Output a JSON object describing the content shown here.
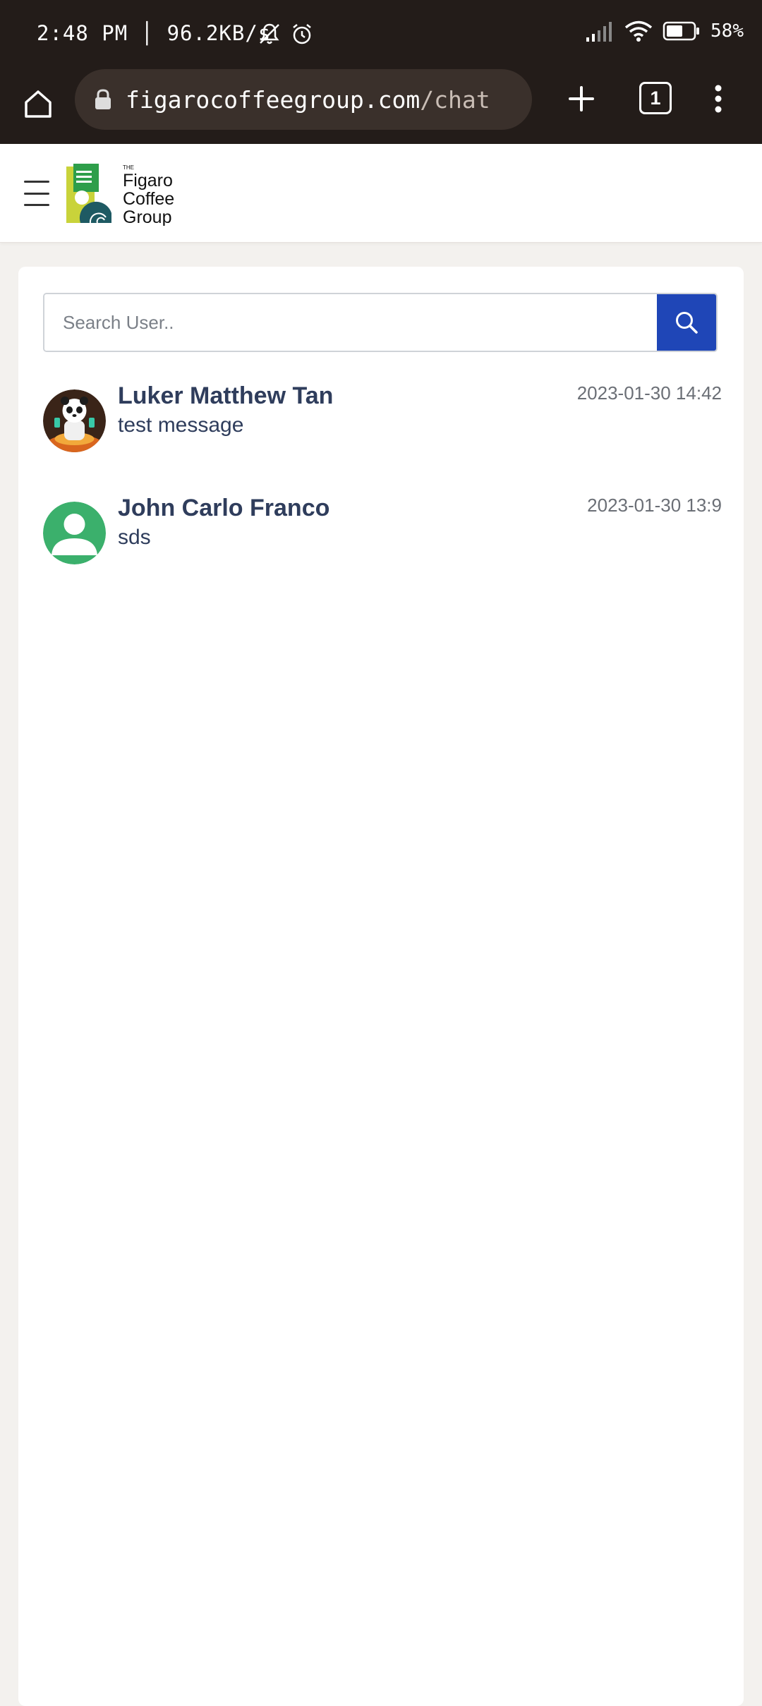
{
  "status_bar": {
    "time": "2:48 PM │ 96.2KB/s",
    "battery": "58%"
  },
  "browser": {
    "url_domain": "figarocoffeegroup.com",
    "url_path": "/chat",
    "tab_count": "1"
  },
  "header": {
    "logo_text": [
      "THE",
      "Figaro",
      "Coffee",
      "Group"
    ]
  },
  "search": {
    "placeholder": "Search User.."
  },
  "chats": [
    {
      "name": "Luker Matthew Tan",
      "message": "test message",
      "time": "2023-01-30 14:42",
      "avatar": "panda-photo"
    },
    {
      "name": "John Carlo Franco",
      "message": "sds",
      "time": "2023-01-30 13:9",
      "avatar": "default-user-icon"
    }
  ],
  "colors": {
    "system_bar": "#231c19",
    "url_box": "#3a302b",
    "search_button": "#1f46b7",
    "name_text": "#2f3d5c",
    "default_avatar": "#3bb06c"
  }
}
